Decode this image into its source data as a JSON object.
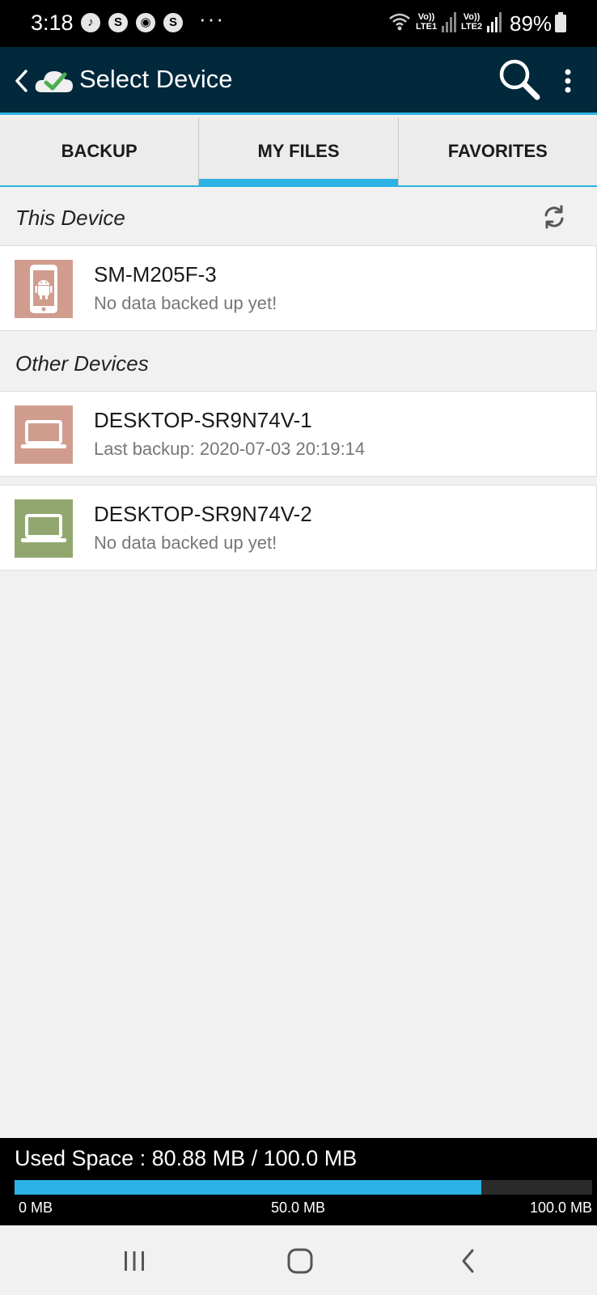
{
  "status_bar": {
    "time": "3:18",
    "notification_icons": [
      "music-icon",
      "skype-icon",
      "circle-icon",
      "skype-icon"
    ],
    "overflow": "···",
    "sim1_label_top": "Vo))",
    "sim1_label_bottom": "LTE1",
    "sim2_label_top": "Vo))",
    "sim2_label_bottom": "LTE2",
    "battery": "89%"
  },
  "app_bar": {
    "title": "Select Device",
    "colors": {
      "bar": "#02283c",
      "accent": "#2cb2e4"
    }
  },
  "tabs": [
    {
      "label": "BACKUP",
      "active": false
    },
    {
      "label": "MY FILES",
      "active": true
    },
    {
      "label": "FAVORITES",
      "active": false
    }
  ],
  "this_device": {
    "header": "This Device",
    "devices": [
      {
        "name": "SM-M205F-3",
        "status": "No data backed up yet!",
        "icon": "android-phone-icon",
        "color": "#d09c8e"
      }
    ]
  },
  "other_devices": {
    "header": "Other Devices",
    "devices": [
      {
        "name": "DESKTOP-SR9N74V-1",
        "status": "Last backup: 2020-07-03 20:19:14",
        "icon": "laptop-icon",
        "color": "#d09c8e"
      },
      {
        "name": "DESKTOP-SR9N74V-2",
        "status": "No data backed up yet!",
        "icon": "laptop-icon",
        "color": "#91a76f"
      }
    ]
  },
  "usage": {
    "label": "Used Space : 80.88 MB /  100.0 MB",
    "used_mb": 80.88,
    "total_mb": 100.0,
    "ticks": [
      "0 MB",
      "50.0 MB",
      "100.0 MB"
    ]
  },
  "nav_bar": {
    "buttons": [
      "recent-apps-icon",
      "home-icon",
      "back-icon"
    ]
  }
}
